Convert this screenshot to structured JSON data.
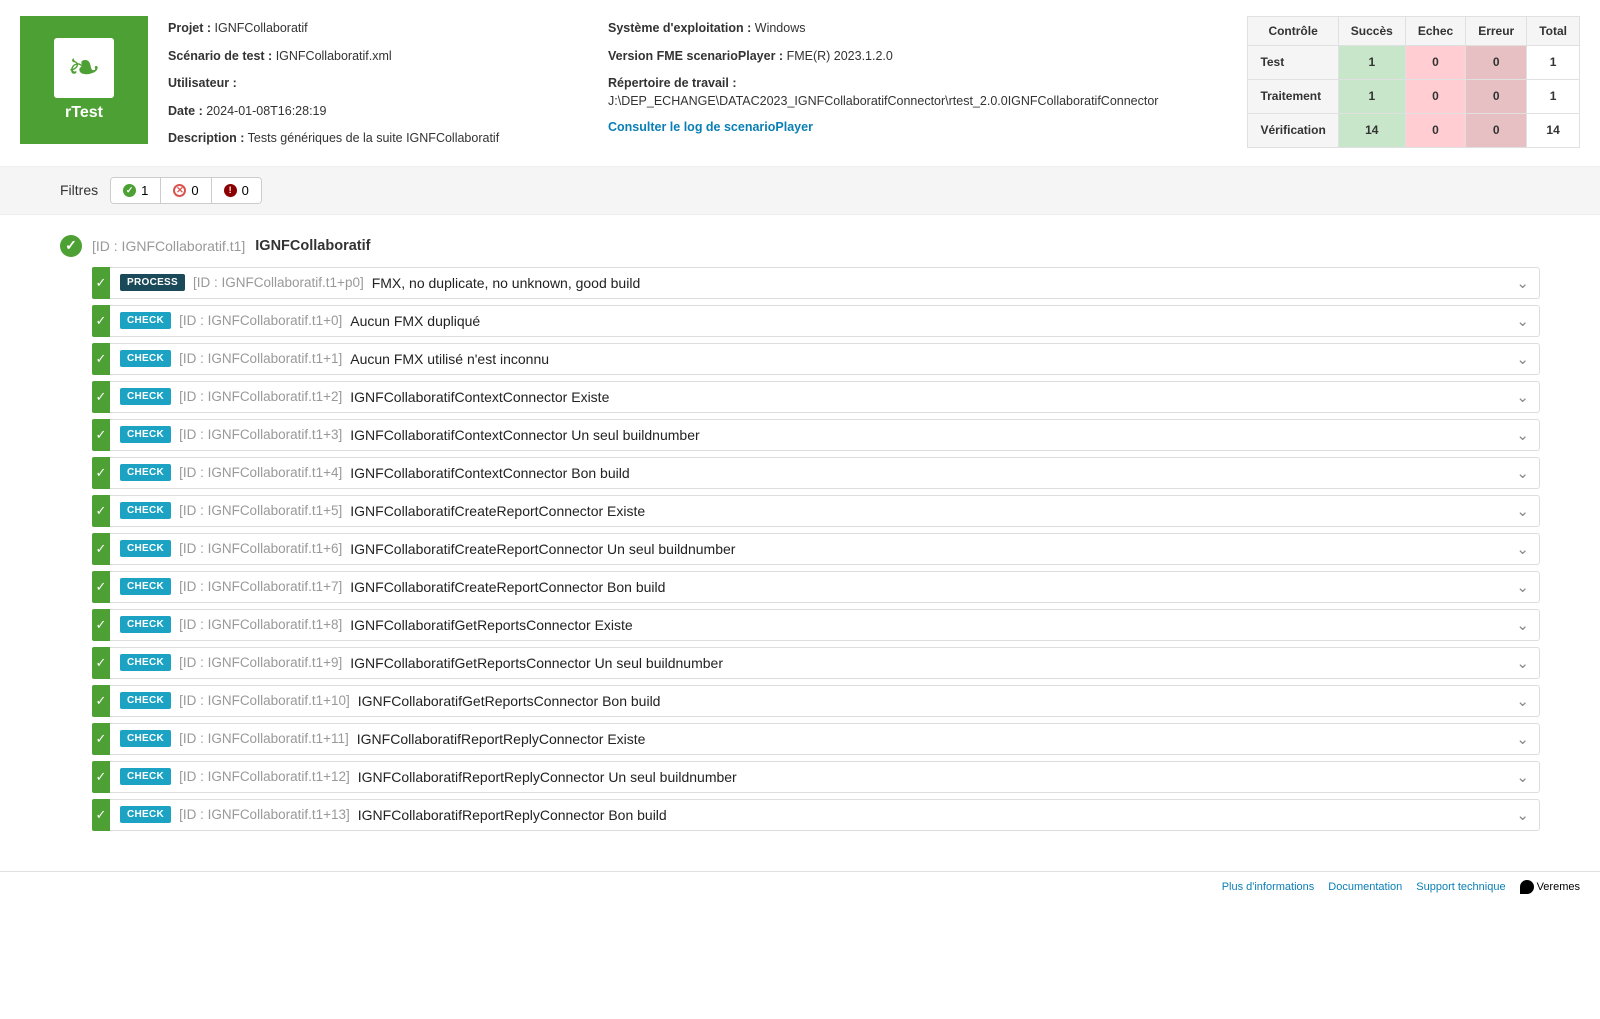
{
  "logo_text": "rTest",
  "info_left": {
    "project_label": "Projet :",
    "project_value": "IGNFCollaboratif",
    "scenario_label": "Scénario de test :",
    "scenario_value": "IGNFCollaboratif.xml",
    "user_label": "Utilisateur :",
    "user_value": "",
    "date_label": "Date :",
    "date_value": "2024-01-08T16:28:19",
    "desc_label": "Description :",
    "desc_value": "Tests génériques de la suite IGNFCollaboratif"
  },
  "info_right": {
    "os_label": "Système d'exploitation :",
    "os_value": "Windows",
    "fme_label": "Version FME scenarioPlayer :",
    "fme_value": "FME(R) 2023.1.2.0",
    "dir_label": "Répertoire de travail :",
    "dir_value": "J:\\DEP_ECHANGE\\DATAC2023_IGNFCollaboratifConnector\\rtest_2.0.0IGNFCollaboratifConnector",
    "log_link": "Consulter le log de scenarioPlayer"
  },
  "summary": {
    "headers": [
      "Contrôle",
      "Succès",
      "Echec",
      "Erreur",
      "Total"
    ],
    "rows": [
      {
        "label": "Test",
        "success": "1",
        "fail": "0",
        "error": "0",
        "total": "1"
      },
      {
        "label": "Traitement",
        "success": "1",
        "fail": "0",
        "error": "0",
        "total": "1"
      },
      {
        "label": "Vérification",
        "success": "14",
        "fail": "0",
        "error": "0",
        "total": "14"
      }
    ]
  },
  "filters": {
    "label": "Filtres",
    "ok_count": "1",
    "fail_count": "0",
    "error_count": "0"
  },
  "group": {
    "id": "[ID : IGNFCollaboratif.t1]",
    "name": "IGNFCollaboratif"
  },
  "items": [
    {
      "type": "PROCESS",
      "id": "[ID : IGNFCollaboratif.t1+p0]",
      "title": "FMX, no duplicate, no unknown, good build"
    },
    {
      "type": "CHECK",
      "id": "[ID : IGNFCollaboratif.t1+0]",
      "title": "Aucun FMX dupliqué"
    },
    {
      "type": "CHECK",
      "id": "[ID : IGNFCollaboratif.t1+1]",
      "title": "Aucun FMX utilisé n'est inconnu"
    },
    {
      "type": "CHECK",
      "id": "[ID : IGNFCollaboratif.t1+2]",
      "title": "IGNFCollaboratifContextConnector Existe"
    },
    {
      "type": "CHECK",
      "id": "[ID : IGNFCollaboratif.t1+3]",
      "title": "IGNFCollaboratifContextConnector Un seul buildnumber"
    },
    {
      "type": "CHECK",
      "id": "[ID : IGNFCollaboratif.t1+4]",
      "title": "IGNFCollaboratifContextConnector Bon build"
    },
    {
      "type": "CHECK",
      "id": "[ID : IGNFCollaboratif.t1+5]",
      "title": "IGNFCollaboratifCreateReportConnector Existe"
    },
    {
      "type": "CHECK",
      "id": "[ID : IGNFCollaboratif.t1+6]",
      "title": "IGNFCollaboratifCreateReportConnector Un seul buildnumber"
    },
    {
      "type": "CHECK",
      "id": "[ID : IGNFCollaboratif.t1+7]",
      "title": "IGNFCollaboratifCreateReportConnector Bon build"
    },
    {
      "type": "CHECK",
      "id": "[ID : IGNFCollaboratif.t1+8]",
      "title": "IGNFCollaboratifGetReportsConnector Existe"
    },
    {
      "type": "CHECK",
      "id": "[ID : IGNFCollaboratif.t1+9]",
      "title": "IGNFCollaboratifGetReportsConnector Un seul buildnumber"
    },
    {
      "type": "CHECK",
      "id": "[ID : IGNFCollaboratif.t1+10]",
      "title": "IGNFCollaboratifGetReportsConnector Bon build"
    },
    {
      "type": "CHECK",
      "id": "[ID : IGNFCollaboratif.t1+11]",
      "title": "IGNFCollaboratifReportReplyConnector Existe"
    },
    {
      "type": "CHECK",
      "id": "[ID : IGNFCollaboratif.t1+12]",
      "title": "IGNFCollaboratifReportReplyConnector Un seul buildnumber"
    },
    {
      "type": "CHECK",
      "id": "[ID : IGNFCollaboratif.t1+13]",
      "title": "IGNFCollaboratifReportReplyConnector Bon build"
    }
  ],
  "footer": {
    "more": "Plus d'informations",
    "docs": "Documentation",
    "support": "Support technique",
    "brand": "Veremes"
  }
}
